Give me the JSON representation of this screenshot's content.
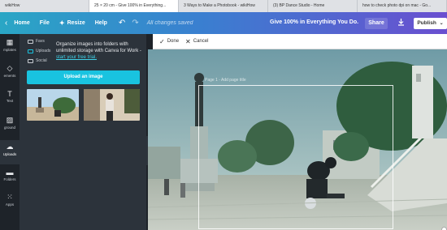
{
  "browser": {
    "tabs": [
      "wikiHow",
      "25 × 20 cm - Give 100% in Everything...",
      "3 Ways to Make a Photobook - wikiHow",
      "(3) BP Dance Studio - Home",
      "how to check photo dpi on mac - Go..."
    ],
    "active_tab_index": 1
  },
  "toolbar": {
    "home": "Home",
    "file": "File",
    "resize": "Resize",
    "help": "Help",
    "saved_status": "All changes saved",
    "doc_title": "Give 100% in Everything You Do.",
    "share": "Share",
    "publish": "Publish"
  },
  "rail": {
    "items": [
      {
        "label": "mplates",
        "icon": "templates-icon"
      },
      {
        "label": "ements",
        "icon": "elements-icon"
      },
      {
        "label": "Text",
        "icon": "text-icon"
      },
      {
        "label": "ground",
        "icon": "background-icon"
      },
      {
        "label": "Uploads",
        "icon": "uploads-icon"
      },
      {
        "label": "Folders",
        "icon": "folders-icon"
      },
      {
        "label": "Apps",
        "icon": "apps-icon"
      }
    ],
    "active_index": 4
  },
  "panel": {
    "folders": [
      "Favs",
      "Uploads",
      "Social"
    ],
    "promo_text": "Organize images into folders with unlimited storage with Canva for Work -",
    "promo_link": "start your free trial.",
    "upload_button": "Upload an image"
  },
  "editor": {
    "done": "Done",
    "cancel": "Cancel",
    "page_label": "Page 1 - Add page title"
  },
  "colors": {
    "accent": "#19c3e0",
    "topbar_start": "#2aa6c5",
    "topbar_end": "#6a4fd0"
  }
}
